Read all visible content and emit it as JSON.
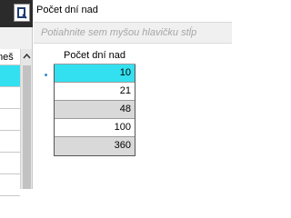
{
  "left": {
    "header_partial": "meš",
    "rows": [
      "",
      "",
      "",
      "",
      "",
      ""
    ]
  },
  "main": {
    "title": "Počet dní nad",
    "group_placeholder": "Potiahnite sem myšou hlavičku stĺp",
    "column_header": "Počet dní nad",
    "rows": [
      "10",
      "21",
      "48",
      "100",
      "360"
    ],
    "selected_index": 0
  },
  "colors": {
    "selection": "#33e0f0",
    "row_alt": "#d9d9d9",
    "group_text": "#a6a6a6"
  },
  "icons": [
    "query-icon",
    "scroll-up-icon",
    "row-indicator-icon"
  ]
}
